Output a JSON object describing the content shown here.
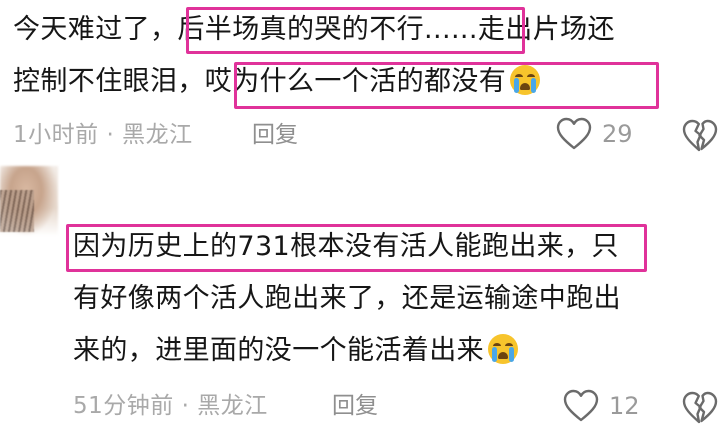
{
  "comments": [
    {
      "lines": [
        "今天难过了，后半场真的哭的不行......走出片场还",
        "控制不住眼泪，哎为什么一个活的都没有"
      ],
      "line2_emoji": "crying-face-icon",
      "time": "1小时前",
      "location": "黑龙江",
      "reply_label": "回复",
      "likes": "29"
    },
    {
      "lines": [
        "因为历史上的731根本没有活人能跑出来，只",
        "有好像两个活人跑出来了，还是运输途中跑出",
        "来的，进里面的没一个能活着出来"
      ],
      "line3_emoji": "crying-face-icon",
      "time": "51分钟前",
      "location": "黑龙江",
      "reply_label": "回复",
      "likes": "12"
    }
  ],
  "separator": "·",
  "highlight_color": "#e0329a"
}
